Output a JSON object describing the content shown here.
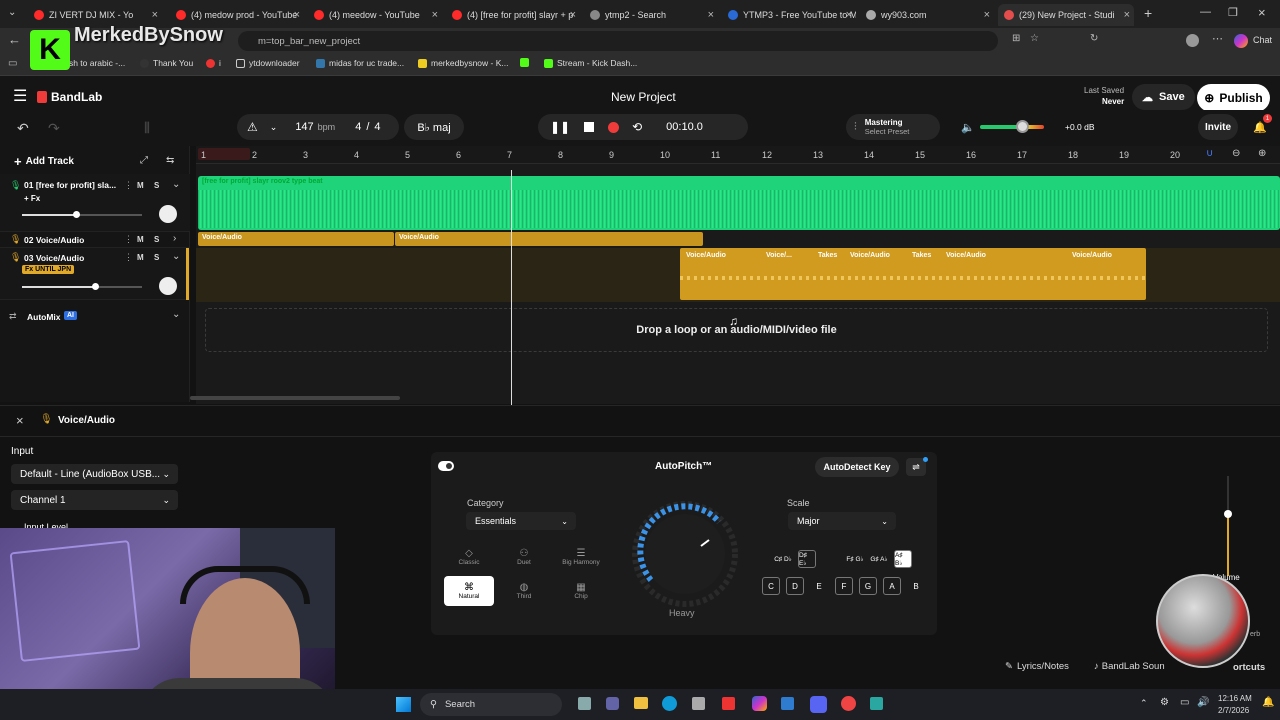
{
  "watermark": "MerkedBySnow",
  "browser": {
    "tabs": [
      {
        "label": "ZI VERT DJ MIX - Yo",
        "color": "#ff2a2a"
      },
      {
        "label": "(4) medow prod - YouTube",
        "color": "#ff2a2a"
      },
      {
        "label": "(4) meedow - YouTube",
        "color": "#ff2a2a"
      },
      {
        "label": "(4) [free for profit] slayr + p",
        "color": "#ff2a2a"
      },
      {
        "label": "ytmp2 - Search",
        "color": "#888"
      },
      {
        "label": "YTMP3 - Free YouTube to M",
        "color": "#2a6ad6"
      },
      {
        "label": "wy903.com",
        "color": "#aaa"
      },
      {
        "label": "(29) New Project - Studi",
        "color": "#e54d4d"
      }
    ],
    "address": "m=top_bar_new_project",
    "bookmarks": [
      "english to arabic -...",
      "Thank You",
      "i",
      "ytdownloader",
      "midas for uc trade...",
      "merkedbysnow - K...",
      "",
      "Stream - Kick Dash..."
    ],
    "chat": "Chat"
  },
  "app": {
    "brand": "BandLab",
    "project_title": "New Project",
    "last_saved_label": "Last Saved",
    "last_saved_value": "Never",
    "save": "Save",
    "publish": "Publish",
    "invite": "Invite",
    "notif_count": "1"
  },
  "toolbar": {
    "bpm": "147",
    "bpm_unit": "bpm",
    "time_sig_top": "4",
    "time_sig_sep": "/",
    "time_sig_bottom": "4",
    "key": "B♭ maj",
    "time": "00:10.0",
    "mastering": "Mastering",
    "mastering_preset": "Select Preset",
    "volume_db": "+0.0 dB"
  },
  "ruler": [
    "1",
    "2",
    "3",
    "4",
    "5",
    "6",
    "7",
    "8",
    "9",
    "10",
    "11",
    "12",
    "13",
    "14",
    "15",
    "16",
    "17",
    "18",
    "19",
    "20"
  ],
  "tracks": {
    "add_track": "Add Track",
    "t1": {
      "name": "01  [free for profit] sla...",
      "fx": "+ Fx",
      "m": "M",
      "s": "S"
    },
    "t2": {
      "name": "02  Voice/Audio",
      "m": "M",
      "s": "S"
    },
    "t3": {
      "name": "03  Voice/Audio",
      "fx": "Fx UNTIL JPN",
      "m": "M",
      "s": "S"
    },
    "automix": "AutoMix",
    "ai": "AI"
  },
  "clips": {
    "c1": "[free for profit] slayr  roov2 type beat",
    "c2a": "Voice/Audio",
    "c2b": "Voice/Audio",
    "c3": [
      "Voice/Audio",
      "Voice/...",
      "Takes",
      "Voice/Audio",
      "Takes",
      "Voice/Audio",
      "Voice/Audio"
    ]
  },
  "dropzone": "Drop a loop or an audio/MIDI/video file",
  "panel": {
    "title": "Voice/Audio",
    "input_label": "Input",
    "input_device": "Default - Line (AudioBox USB...",
    "channel": "Channel 1",
    "input_level": "Input Level"
  },
  "autopitch": {
    "title": "AutoPitch™",
    "autodetect": "AutoDetect Key",
    "category_label": "Category",
    "category_value": "Essentials",
    "presets": [
      "Classic",
      "Duet",
      "Big Harmony",
      "Natural",
      "Third",
      "Chip"
    ],
    "knob_label": "Heavy",
    "scale_label": "Scale",
    "scale_value": "Major",
    "sharps": [
      "C♯ D♭",
      "D♯ E♭",
      "F♯ G♭",
      "G♯ A♭",
      "A♯ B♭"
    ],
    "naturals": [
      "C",
      "D",
      "E",
      "F",
      "G",
      "A",
      "B"
    ]
  },
  "right_panel": {
    "volume": "Volume",
    "reverb": "erb"
  },
  "footer": {
    "lyrics": "Lyrics/Notes",
    "sounds": "BandLab Soun",
    "shortcuts": "ortcuts"
  },
  "taskbar": {
    "search": "Search",
    "time": "12:16 AM",
    "date": "2/7/2026"
  }
}
